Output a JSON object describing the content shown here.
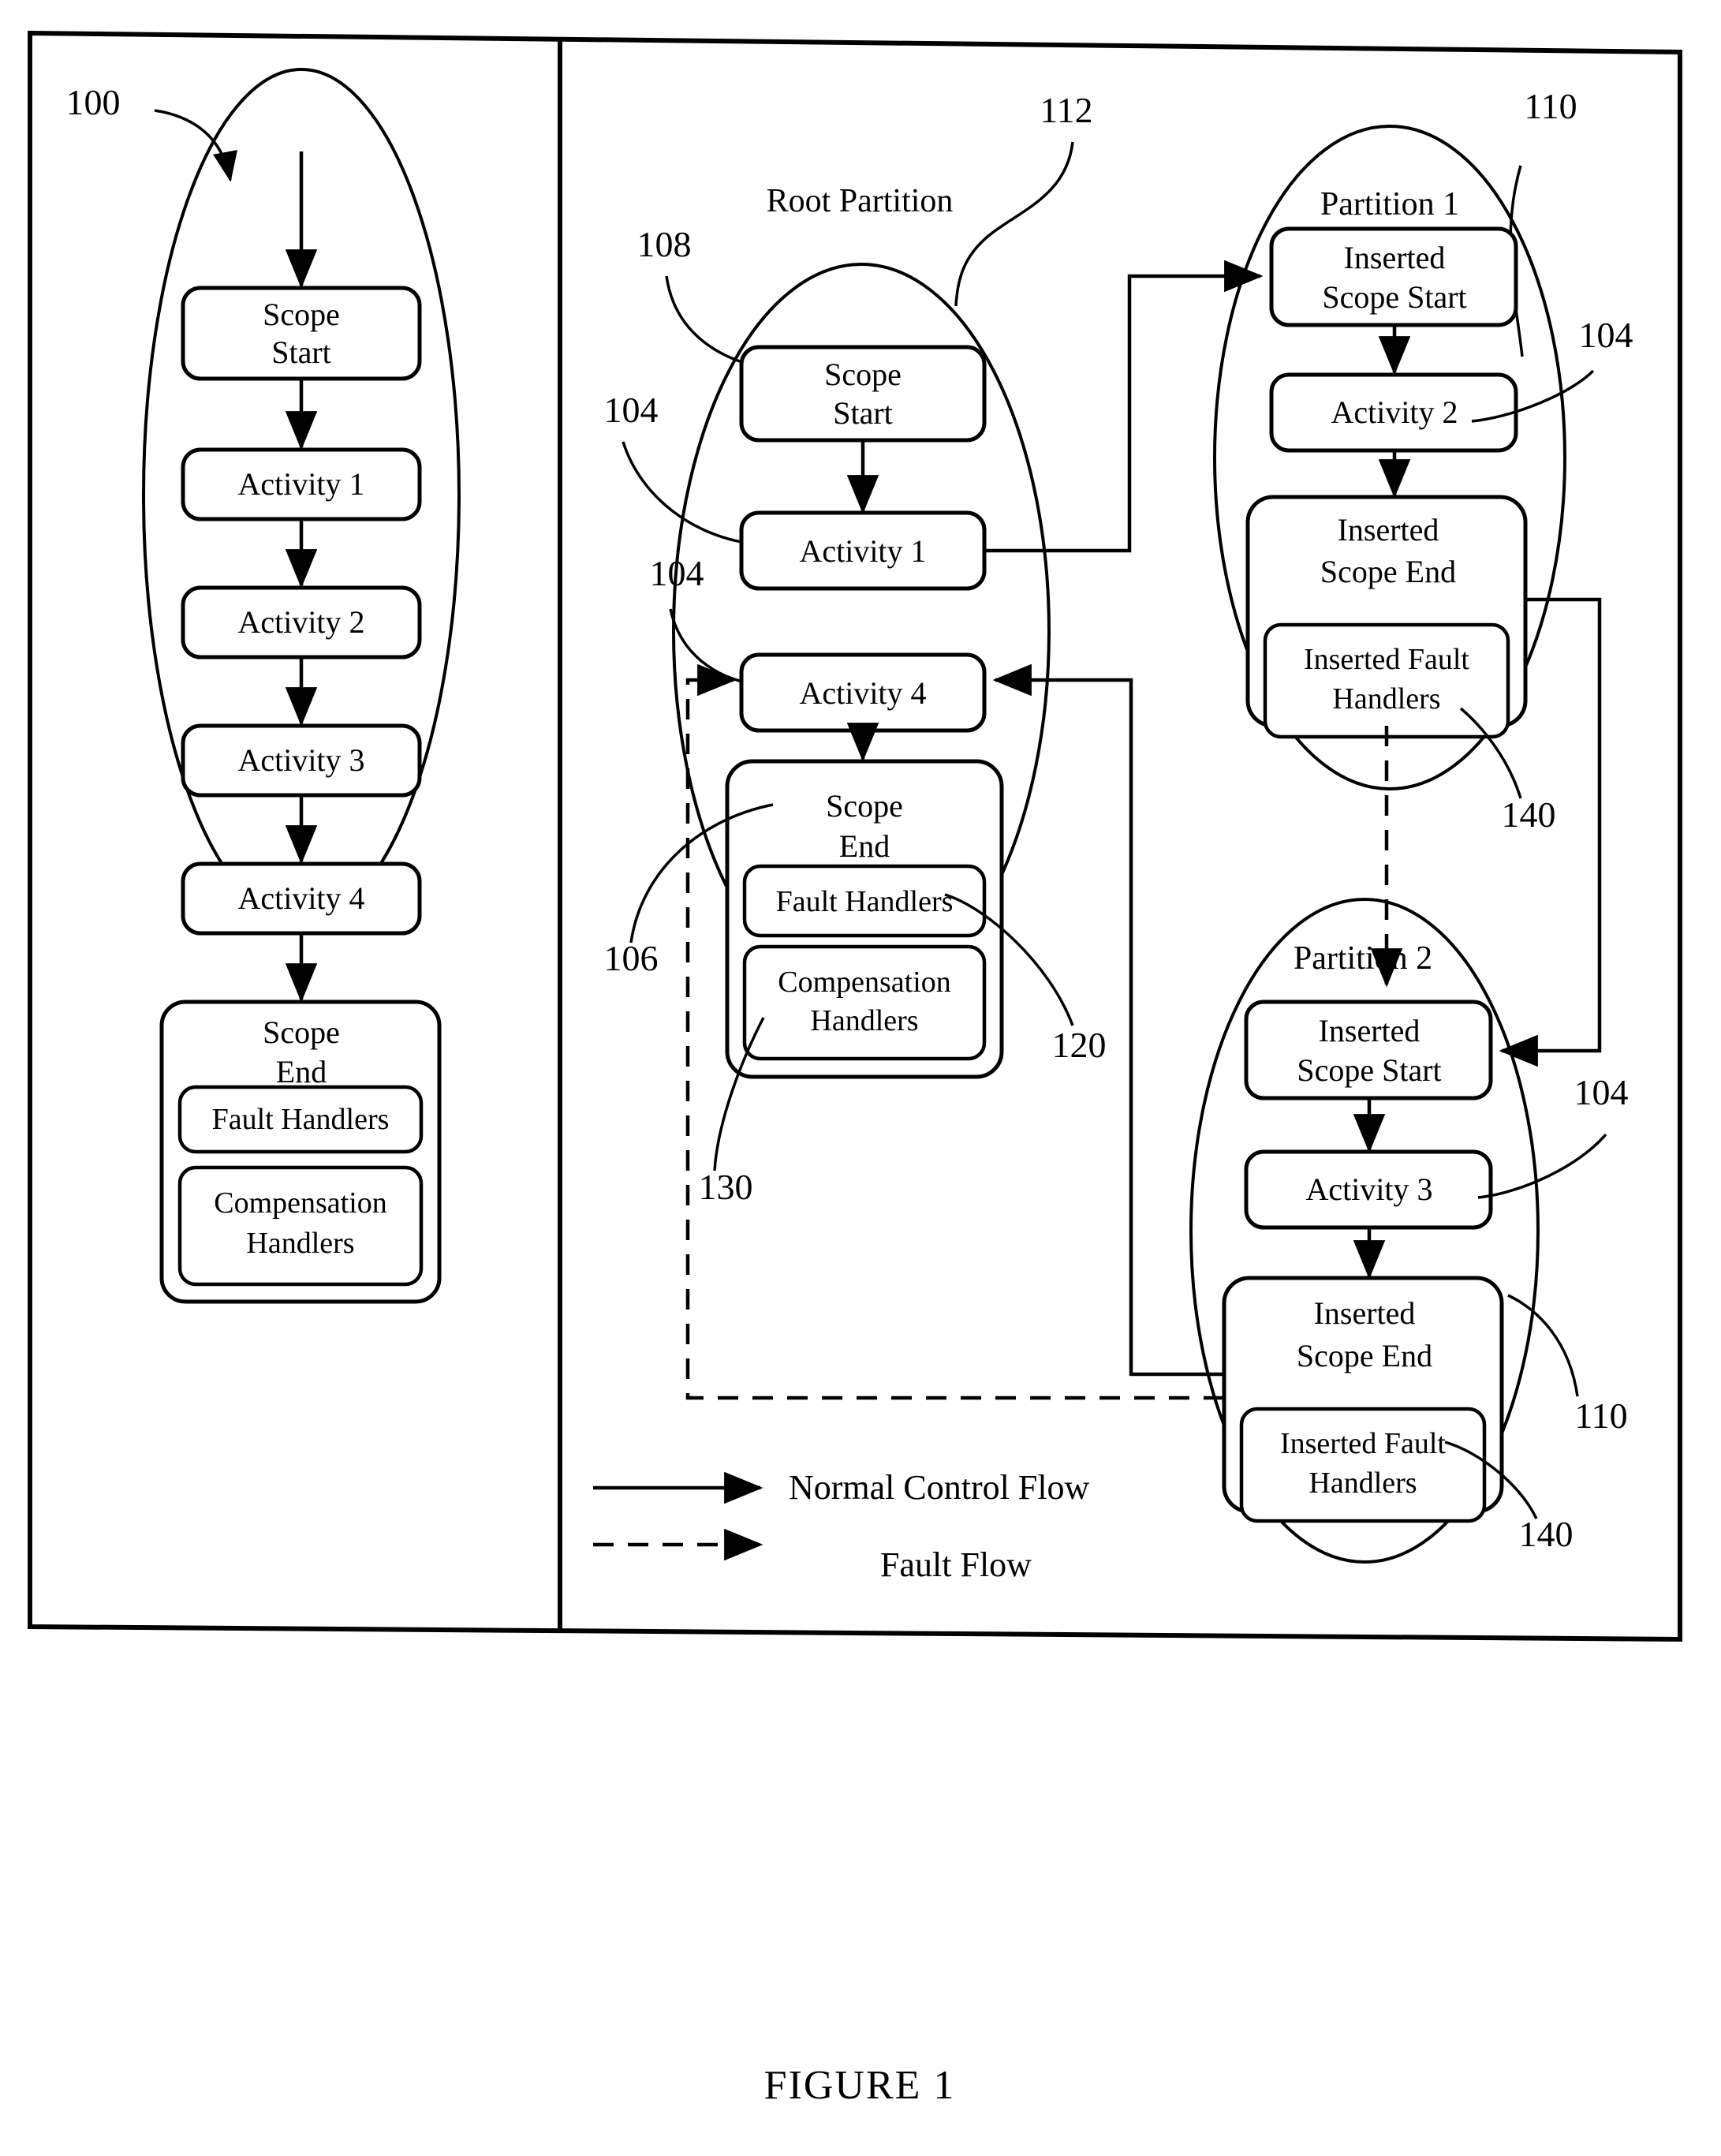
{
  "figure": {
    "caption": "FIGURE 1"
  },
  "left_panel": {
    "ref_label": "100",
    "nodes": [
      {
        "id": "scope-start",
        "line1": "Scope",
        "line2": "Start"
      },
      {
        "id": "activity-1",
        "line1": "Activity 1",
        "line2": ""
      },
      {
        "id": "activity-2",
        "line1": "Activity 2",
        "line2": ""
      },
      {
        "id": "activity-3",
        "line1": "Activity 3",
        "line2": ""
      },
      {
        "id": "activity-4",
        "line1": "Activity 4",
        "line2": ""
      },
      {
        "id": "scope-end",
        "line1": "Scope",
        "line2": "End"
      }
    ],
    "scope_end_children": [
      {
        "id": "fault-handlers",
        "line1": "Fault Handlers",
        "line2": ""
      },
      {
        "id": "compensation-handlers",
        "line1": "Compensation",
        "line2": "Handlers"
      }
    ]
  },
  "right_panel": {
    "root_partition": {
      "title": "Root Partition",
      "ref_title": "112",
      "ref_scope_start": "108",
      "ref_activity_1": "104",
      "ref_activity_4": "104",
      "ref_scope_end": "106",
      "ref_fault_handlers": "120",
      "ref_compensation_handlers": "130",
      "nodes": [
        {
          "id": "scope-start",
          "line1": "Scope",
          "line2": "Start"
        },
        {
          "id": "activity-1",
          "line1": "Activity 1",
          "line2": ""
        },
        {
          "id": "activity-4",
          "line1": "Activity 4",
          "line2": ""
        },
        {
          "id": "scope-end",
          "line1": "Scope",
          "line2": "End"
        }
      ],
      "scope_end_children": [
        {
          "id": "fault-handlers",
          "line1": "Fault Handlers",
          "line2": ""
        },
        {
          "id": "compensation-handlers",
          "line1": "Compensation",
          "line2": "Handlers"
        }
      ]
    },
    "partition_1": {
      "title": "Partition 1",
      "ref_partition": "110",
      "ref_activity": "104",
      "ref_fault_handlers": "140",
      "nodes": [
        {
          "id": "inserted-scope-start",
          "line1": "Inserted",
          "line2": "Scope Start"
        },
        {
          "id": "activity-2",
          "line1": "Activity 2",
          "line2": ""
        },
        {
          "id": "inserted-scope-end",
          "line1": "Inserted",
          "line2": "Scope End"
        }
      ],
      "inserted_fault_handlers": {
        "line1": "Inserted Fault",
        "line2": "Handlers"
      }
    },
    "partition_2": {
      "title": "Partition 2",
      "ref_partition": "110",
      "ref_activity": "104",
      "ref_fault_handlers": "140",
      "nodes": [
        {
          "id": "inserted-scope-start",
          "line1": "Inserted",
          "line2": "Scope Start"
        },
        {
          "id": "activity-3",
          "line1": "Activity 3",
          "line2": ""
        },
        {
          "id": "inserted-scope-end",
          "line1": "Inserted",
          "line2": "Scope End"
        }
      ],
      "inserted_fault_handlers": {
        "line1": "Inserted Fault",
        "line2": "Handlers"
      }
    },
    "legend": {
      "normal_flow": "Normal Control Flow",
      "fault_flow": "Fault Flow"
    }
  }
}
